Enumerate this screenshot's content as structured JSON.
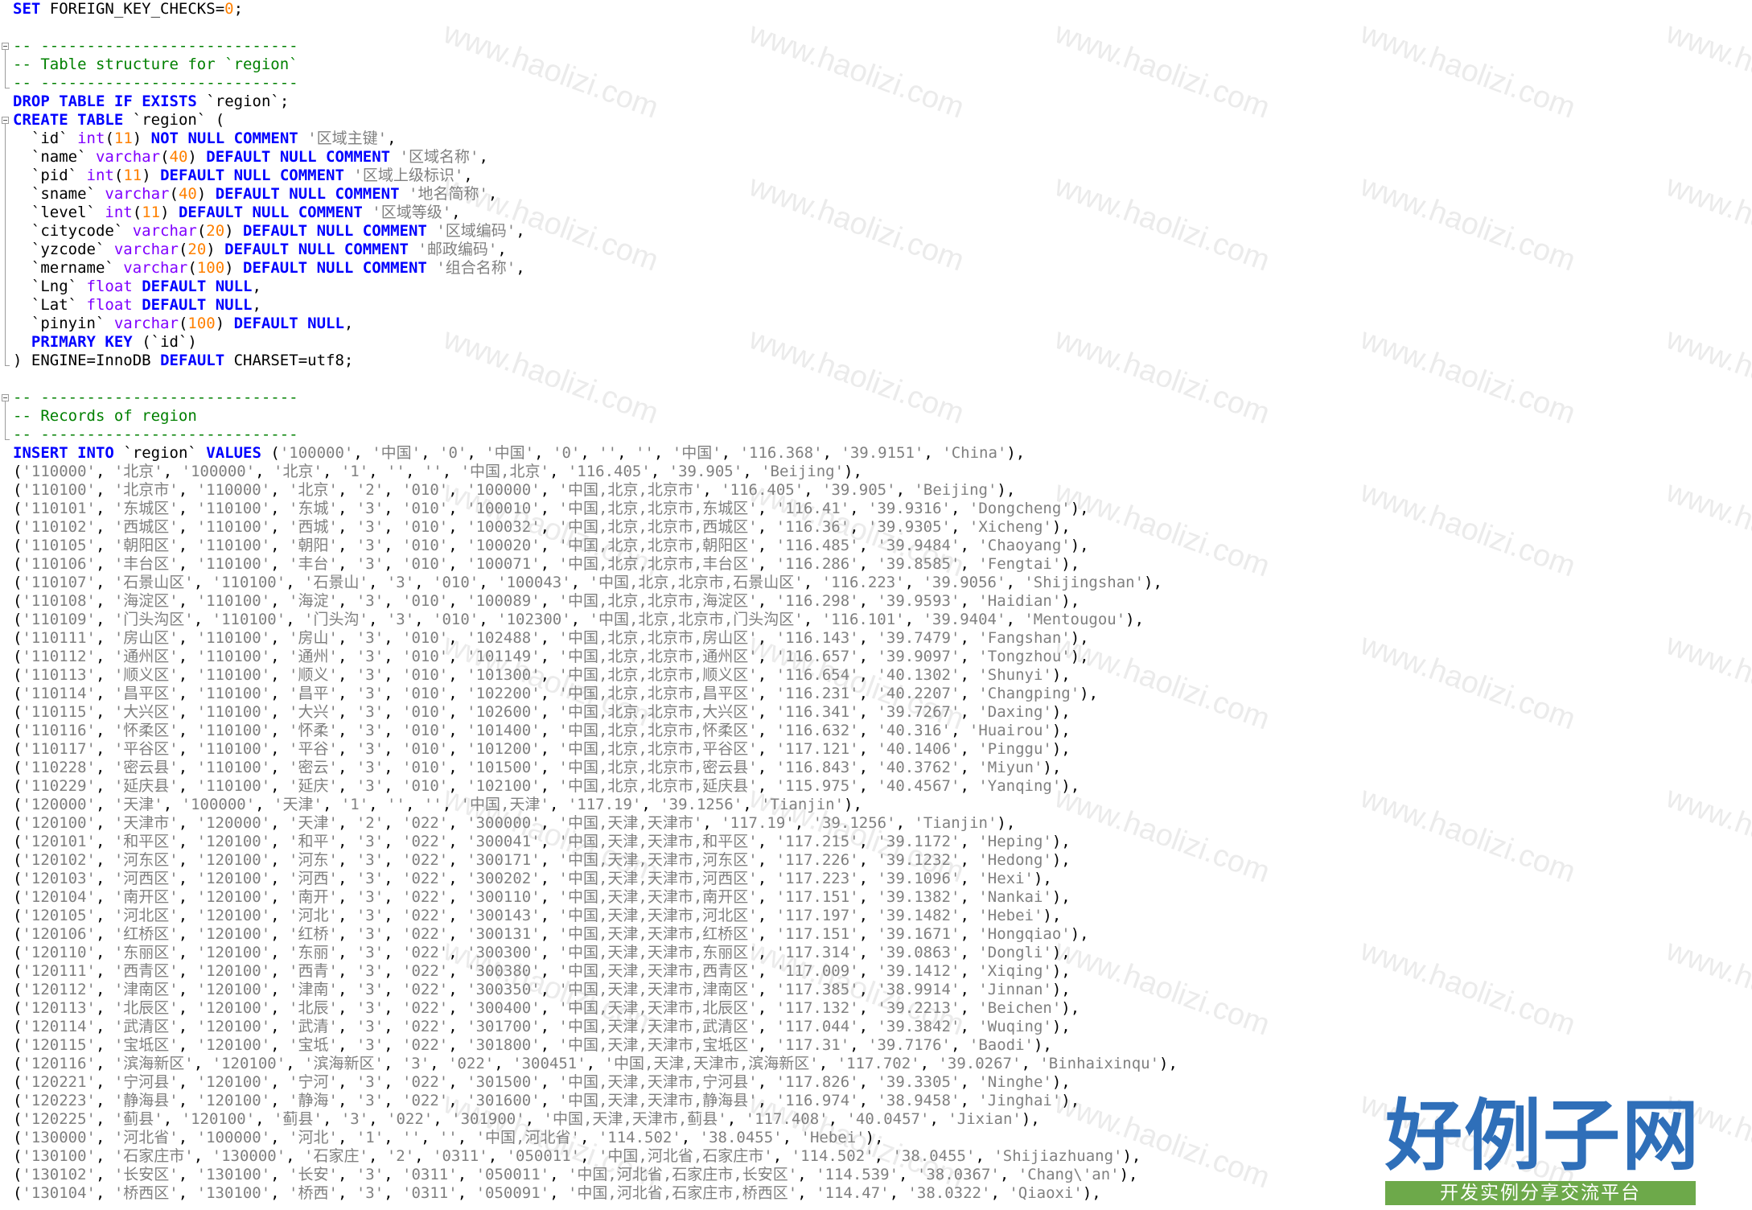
{
  "editor": {
    "language": "SQL",
    "colors": {
      "keyword": "#0000ff",
      "type": "#8000ff",
      "number": "#ff8000",
      "string": "#808080",
      "comment": "#008000",
      "plain": "#000000",
      "background": "#ffffff"
    },
    "fold_markers": [
      {
        "icon": "fold-minus-icon",
        "line": 3
      },
      {
        "icon": "fold-minus-icon",
        "line": 7
      },
      {
        "icon": "fold-minus-icon",
        "line": 22
      }
    ],
    "lines": [
      "SET FOREIGN_KEY_CHECKS=0;",
      "",
      "-- ----------------------------",
      "-- Table structure for `region`",
      "-- ----------------------------",
      "DROP TABLE IF EXISTS `region`;",
      "CREATE TABLE `region` (",
      "  `id` int(11) NOT NULL COMMENT '区域主键',",
      "  `name` varchar(40) DEFAULT NULL COMMENT '区域名称',",
      "  `pid` int(11) DEFAULT NULL COMMENT '区域上级标识',",
      "  `sname` varchar(40) DEFAULT NULL COMMENT '地名简称',",
      "  `level` int(11) DEFAULT NULL COMMENT '区域等级',",
      "  `citycode` varchar(20) DEFAULT NULL COMMENT '区域编码',",
      "  `yzcode` varchar(20) DEFAULT NULL COMMENT '邮政编码',",
      "  `mername` varchar(100) DEFAULT NULL COMMENT '组合名称',",
      "  `Lng` float DEFAULT NULL,",
      "  `Lat` float DEFAULT NULL,",
      "  `pinyin` varchar(100) DEFAULT NULL,",
      "  PRIMARY KEY (`id`)",
      ") ENGINE=InnoDB DEFAULT CHARSET=utf8;",
      "",
      "-- ----------------------------",
      "-- Records of region",
      "-- ----------------------------",
      "INSERT INTO `region` VALUES ('100000', '中国', '0', '中国', '0', '', '', '中国', '116.368', '39.9151', 'China'),",
      "('110000', '北京', '100000', '北京', '1', '', '', '中国,北京', '116.405', '39.905', 'Beijing'),",
      "('110100', '北京市', '110000', '北京', '2', '010', '100000', '中国,北京,北京市', '116.405', '39.905', 'Beijing'),",
      "('110101', '东城区', '110100', '东城', '3', '010', '100010', '中国,北京,北京市,东城区', '116.41', '39.9316', 'Dongcheng'),",
      "('110102', '西城区', '110100', '西城', '3', '010', '100032', '中国,北京,北京市,西城区', '116.36', '39.9305', 'Xicheng'),",
      "('110105', '朝阳区', '110100', '朝阳', '3', '010', '100020', '中国,北京,北京市,朝阳区', '116.485', '39.9484', 'Chaoyang'),",
      "('110106', '丰台区', '110100', '丰台', '3', '010', '100071', '中国,北京,北京市,丰台区', '116.286', '39.8585', 'Fengtai'),",
      "('110107', '石景山区', '110100', '石景山', '3', '010', '100043', '中国,北京,北京市,石景山区', '116.223', '39.9056', 'Shijingshan'),",
      "('110108', '海淀区', '110100', '海淀', '3', '010', '100089', '中国,北京,北京市,海淀区', '116.298', '39.9593', 'Haidian'),",
      "('110109', '门头沟区', '110100', '门头沟', '3', '010', '102300', '中国,北京,北京市,门头沟区', '116.101', '39.9404', 'Mentougou'),",
      "('110111', '房山区', '110100', '房山', '3', '010', '102488', '中国,北京,北京市,房山区', '116.143', '39.7479', 'Fangshan'),",
      "('110112', '通州区', '110100', '通州', '3', '010', '101149', '中国,北京,北京市,通州区', '116.657', '39.9097', 'Tongzhou'),",
      "('110113', '顺义区', '110100', '顺义', '3', '010', '101300', '中国,北京,北京市,顺义区', '116.654', '40.1302', 'Shunyi'),",
      "('110114', '昌平区', '110100', '昌平', '3', '010', '102200', '中国,北京,北京市,昌平区', '116.231', '40.2207', 'Changping'),",
      "('110115', '大兴区', '110100', '大兴', '3', '010', '102600', '中国,北京,北京市,大兴区', '116.341', '39.7267', 'Daxing'),",
      "('110116', '怀柔区', '110100', '怀柔', '3', '010', '101400', '中国,北京,北京市,怀柔区', '116.632', '40.316', 'Huairou'),",
      "('110117', '平谷区', '110100', '平谷', '3', '010', '101200', '中国,北京,北京市,平谷区', '117.121', '40.1406', 'Pinggu'),",
      "('110228', '密云县', '110100', '密云', '3', '010', '101500', '中国,北京,北京市,密云县', '116.843', '40.3762', 'Miyun'),",
      "('110229', '延庆县', '110100', '延庆', '3', '010', '102100', '中国,北京,北京市,延庆县', '115.975', '40.4567', 'Yanqing'),",
      "('120000', '天津', '100000', '天津', '1', '', '', '中国,天津', '117.19', '39.1256', 'Tianjin'),",
      "('120100', '天津市', '120000', '天津', '2', '022', '300000', '中国,天津,天津市', '117.19', '39.1256', 'Tianjin'),",
      "('120101', '和平区', '120100', '和平', '3', '022', '300041', '中国,天津,天津市,和平区', '117.215', '39.1172', 'Heping'),",
      "('120102', '河东区', '120100', '河东', '3', '022', '300171', '中国,天津,天津市,河东区', '117.226', '39.1232', 'Hedong'),",
      "('120103', '河西区', '120100', '河西', '3', '022', '300202', '中国,天津,天津市,河西区', '117.223', '39.1096', 'Hexi'),",
      "('120104', '南开区', '120100', '南开', '3', '022', '300110', '中国,天津,天津市,南开区', '117.151', '39.1382', 'Nankai'),",
      "('120105', '河北区', '120100', '河北', '3', '022', '300143', '中国,天津,天津市,河北区', '117.197', '39.1482', 'Hebei'),",
      "('120106', '红桥区', '120100', '红桥', '3', '022', '300131', '中国,天津,天津市,红桥区', '117.151', '39.1671', 'Hongqiao'),",
      "('120110', '东丽区', '120100', '东丽', '3', '022', '300300', '中国,天津,天津市,东丽区', '117.314', '39.0863', 'Dongli'),",
      "('120111', '西青区', '120100', '西青', '3', '022', '300380', '中国,天津,天津市,西青区', '117.009', '39.1412', 'Xiqing'),",
      "('120112', '津南区', '120100', '津南', '3', '022', '300350', '中国,天津,天津市,津南区', '117.385', '38.9914', 'Jinnan'),",
      "('120113', '北辰区', '120100', '北辰', '3', '022', '300400', '中国,天津,天津市,北辰区', '117.132', '39.2213', 'Beichen'),",
      "('120114', '武清区', '120100', '武清', '3', '022', '301700', '中国,天津,天津市,武清区', '117.044', '39.3842', 'Wuqing'),",
      "('120115', '宝坻区', '120100', '宝坻', '3', '022', '301800', '中国,天津,天津市,宝坻区', '117.31', '39.7176', 'Baodi'),",
      "('120116', '滨海新区', '120100', '滨海新区', '3', '022', '300451', '中国,天津,天津市,滨海新区', '117.702', '39.0267', 'Binhaixinqu'),",
      "('120221', '宁河县', '120100', '宁河', '3', '022', '301500', '中国,天津,天津市,宁河县', '117.826', '39.3305', 'Ninghe'),",
      "('120223', '静海县', '120100', '静海', '3', '022', '301600', '中国,天津,天津市,静海县', '116.974', '38.9458', 'Jinghai'),",
      "('120225', '蓟县', '120100', '蓟县', '3', '022', '301900', '中国,天津,天津市,蓟县', '117.408', '40.0457', 'Jixian'),",
      "('130000', '河北省', '100000', '河北', '1', '', '', '中国,河北省', '114.502', '38.0455', 'Hebei'),",
      "('130100', '石家庄市', '130000', '石家庄', '2', '0311', '050011', '中国,河北省,石家庄市', '114.502', '38.0455', 'Shijiazhuang'),",
      "('130102', '长安区', '130100', '长安', '3', '0311', '050011', '中国,河北省,石家庄市,长安区', '114.539', '38.0367', 'Chang\\'an'),",
      "('130104', '桥西区', '130100', '桥西', '3', '0311', '050091', '中国,河北省,石家庄市,桥西区', '114.47', '38.0322', 'Qiaoxi'),"
    ]
  },
  "watermark": {
    "text": "www.haolizi.com"
  },
  "brand": {
    "title": "好例子网",
    "slogan": "开发实例分享交流平台"
  }
}
